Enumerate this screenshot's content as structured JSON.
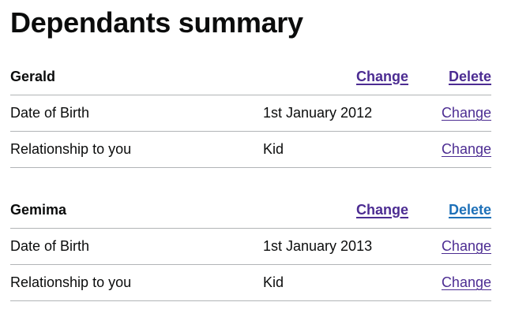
{
  "page": {
    "title": "Dependants summary"
  },
  "dependants": [
    {
      "name": "Gerald",
      "change_label": "Change",
      "delete_label": "Delete",
      "rows": [
        {
          "key": "Date of Birth",
          "value": "1st January 2012",
          "action": "Change"
        },
        {
          "key": "Relationship to you",
          "value": "Kid",
          "action": "Change"
        }
      ]
    },
    {
      "name": "Gemima",
      "change_label": "Change",
      "delete_label": "Delete",
      "rows": [
        {
          "key": "Date of Birth",
          "value": "1st January 2013",
          "action": "Change"
        },
        {
          "key": "Relationship to you",
          "value": "Kid",
          "action": "Change"
        }
      ]
    }
  ],
  "colors": {
    "text": "#0b0c0c",
    "link": "#4c2c92",
    "link_focus": "#1d70b8",
    "border": "#b1b4b6"
  }
}
